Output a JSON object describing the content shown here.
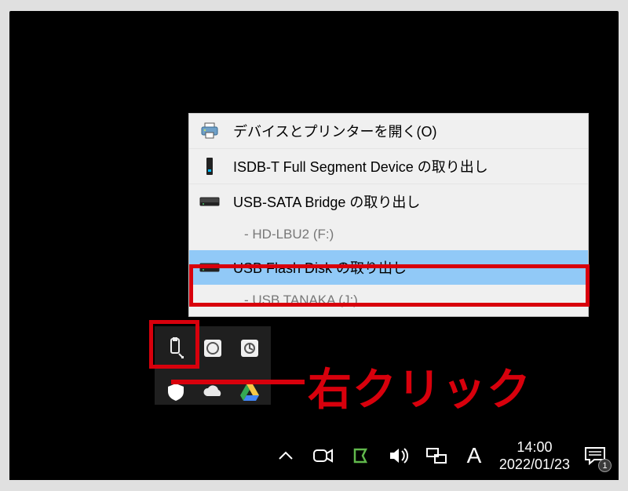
{
  "annotation": {
    "label": "右クリック"
  },
  "menu": {
    "items": [
      {
        "icon": "printer-icon",
        "label": "デバイスとプリンターを開く(O)"
      },
      {
        "icon": "tuner-icon",
        "label": "ISDB-T Full Segment Device の取り出し"
      },
      {
        "icon": "drive-icon",
        "label": "USB-SATA Bridge の取り出し",
        "sub": "-   HD-LBU2 (F:)"
      },
      {
        "icon": "drive-icon",
        "label": "USB Flash Disk の取り出し",
        "sub": "-   USB TANAKA (J:)",
        "highlight": true
      }
    ]
  },
  "tray": {
    "eject_icon": "eject-usb-icon"
  },
  "taskbar": {
    "ime_letter": "A",
    "time": "14:00",
    "date": "2022/01/23",
    "notif_count": "1"
  }
}
